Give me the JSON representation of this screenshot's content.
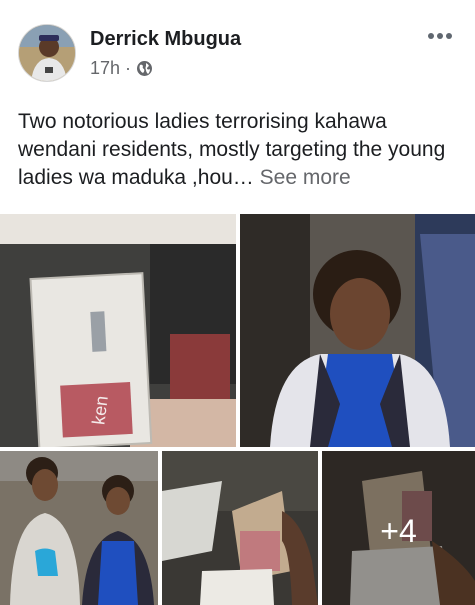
{
  "post": {
    "author": "Derrick Mbugua",
    "time": "17h",
    "separator": "·",
    "caption": "Two notorious ladies terrorising kahawa wendani residents, mostly targeting the young ladies wa maduka ,hou…",
    "see_more": "See more",
    "icons": {
      "more": "more-horizontal-icon",
      "audience": "globe-icon"
    }
  },
  "photos": {
    "more_count": "+4",
    "envelope_text": "ken"
  },
  "colors": {
    "text": "#1c1e21",
    "muted": "#65676b"
  }
}
